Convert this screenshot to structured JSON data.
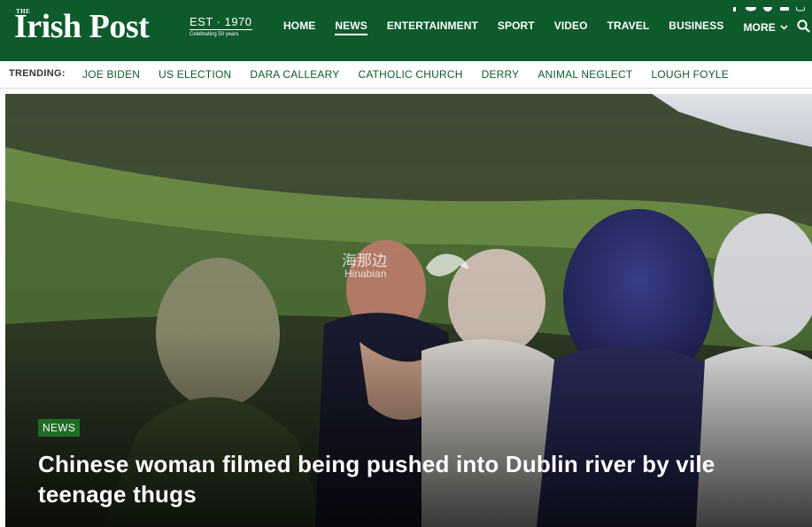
{
  "logo": {
    "prefix": "THE",
    "name": "Irish Post",
    "est": "EST · 1970",
    "tagline": "Celebrating 50 years"
  },
  "nav": {
    "items": [
      {
        "label": "HOME",
        "active": false
      },
      {
        "label": "NEWS",
        "active": true
      },
      {
        "label": "ENTERTAINMENT",
        "active": false
      },
      {
        "label": "SPORT",
        "active": false
      },
      {
        "label": "VIDEO",
        "active": false
      },
      {
        "label": "TRAVEL",
        "active": false
      },
      {
        "label": "BUSINESS",
        "active": false
      },
      {
        "label": "MORE",
        "active": false
      }
    ],
    "search_icon": "search-icon",
    "more_icon": "chevron-down-icon"
  },
  "trending": {
    "label": "TRENDING:",
    "items": [
      "JOE BIDEN",
      "US ELECTION",
      "DARA CALLEARY",
      "CATHOLIC CHURCH",
      "DERRY",
      "ANIMAL NEGLECT",
      "LOUGH FOYLE"
    ]
  },
  "hero": {
    "category": "NEWS",
    "title": "Chinese woman filmed being pushed into Dublin river by vile teenage thugs",
    "watermark_cn": "海那边",
    "watermark_en": "Hinabian"
  },
  "colors": {
    "brand_green": "#0d5a2b",
    "badge_green": "#1f6b24",
    "trend_text": "#0d5a2b"
  }
}
